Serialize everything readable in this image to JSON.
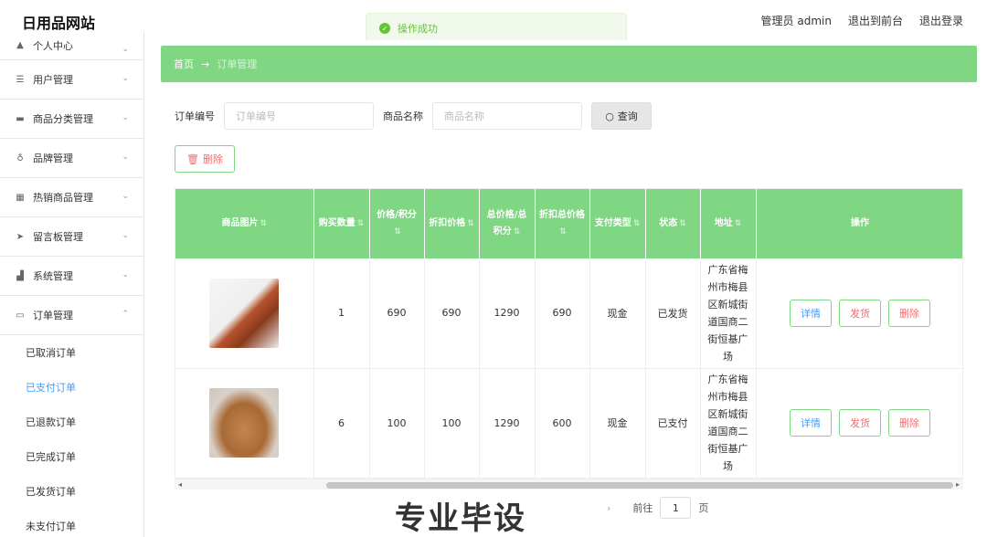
{
  "header": {
    "logo": "日用品网站",
    "admin": "管理员 admin",
    "back_front": "退出到前台",
    "logout": "退出登录"
  },
  "toast": {
    "text": "操作成功",
    "icon": "success-check-icon"
  },
  "sidebar": {
    "items": [
      {
        "label": "个人中心",
        "icon": "person-icon",
        "arrow": "chevron-down-icon"
      },
      {
        "label": "用户管理",
        "icon": "list-icon",
        "arrow": "chevron-down-icon"
      },
      {
        "label": "商品分类管理",
        "icon": "category-icon",
        "arrow": "chevron-down-icon"
      },
      {
        "label": "品牌管理",
        "icon": "mic-icon",
        "arrow": "chevron-down-icon"
      },
      {
        "label": "热销商品管理",
        "icon": "grid-icon",
        "arrow": "chevron-down-icon"
      },
      {
        "label": "留言板管理",
        "icon": "send-icon",
        "arrow": "chevron-down-icon"
      },
      {
        "label": "系统管理",
        "icon": "system-icon",
        "arrow": "chevron-down-icon"
      },
      {
        "label": "订单管理",
        "icon": "order-icon",
        "arrow": "chevron-up-icon"
      }
    ],
    "submenu": [
      "已取消订单",
      "已支付订单",
      "已退款订单",
      "已完成订单",
      "已发货订单",
      "未支付订单"
    ],
    "active_submenu": "已支付订单"
  },
  "breadcrumb": {
    "home": "首页",
    "separator": "→",
    "current": "订单管理"
  },
  "search": {
    "order_no_label": "订单编号",
    "order_no_placeholder": "订单编号",
    "product_label": "商品名称",
    "product_placeholder": "商品名称",
    "query_label": "查询",
    "query_icon": "search-icon"
  },
  "delete_button": {
    "label": "删除",
    "icon": "trash-icon"
  },
  "table": {
    "columns": [
      "商品图片",
      "购买数量",
      "价格/积分",
      "折扣价格",
      "总价格/总积分",
      "折扣总价格",
      "支付类型",
      "状态",
      "地址",
      "操作"
    ],
    "rows": [
      {
        "image": "product-thumb-glasses-bottle",
        "qty": "1",
        "price": "690",
        "discount_price": "690",
        "total": "1290",
        "discount_total": "690",
        "pay_type": "现金",
        "status": "已发货",
        "address": "广东省梅州市梅县区新城街道国商二街恒基广场"
      },
      {
        "image": "product-thumb-basket",
        "qty": "6",
        "price": "100",
        "discount_price": "100",
        "total": "1290",
        "discount_total": "600",
        "pay_type": "现金",
        "status": "已支付",
        "address": "广东省梅州市梅县区新城街道国商二街恒基广场"
      }
    ],
    "ops": {
      "detail": "详情",
      "ship": "发货",
      "delete": "删除"
    }
  },
  "pagination": {
    "goto_label": "前往",
    "page_value": "1",
    "page_suffix": "页",
    "next_icon": "chevron-right-icon"
  },
  "watermark": "专业毕设"
}
